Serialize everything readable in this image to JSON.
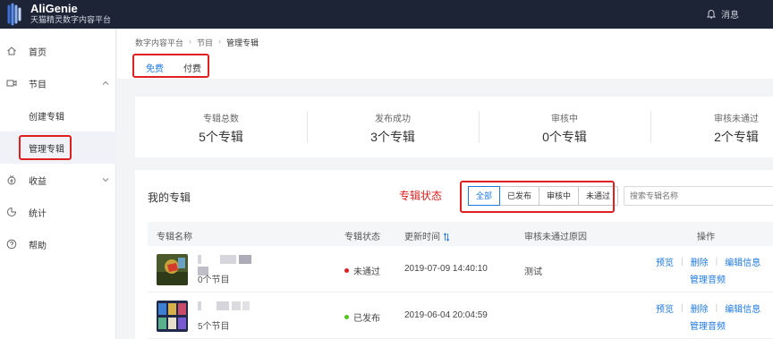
{
  "app": {
    "name": "AliGenie",
    "subtitle": "天猫精灵数字内容平台"
  },
  "topbar": {
    "notify_label": "消息"
  },
  "sidebar": {
    "items": [
      {
        "label": "首页",
        "icon": "home-icon"
      },
      {
        "label": "节目",
        "icon": "video-icon"
      },
      {
        "label": "创建专辑"
      },
      {
        "label": "管理专辑"
      },
      {
        "label": "收益",
        "icon": "money-icon"
      },
      {
        "label": "统计",
        "icon": "chart-icon"
      },
      {
        "label": "帮助",
        "icon": "help-icon"
      }
    ]
  },
  "breadcrumb": [
    "数字内容平台",
    "节目",
    "管理专辑"
  ],
  "tabs": [
    {
      "label": "免费",
      "active": true
    },
    {
      "label": "付费",
      "active": false
    }
  ],
  "stats": [
    {
      "title": "专辑总数",
      "value": "5个专辑"
    },
    {
      "title": "发布成功",
      "value": "3个专辑"
    },
    {
      "title": "审核中",
      "value": "0个专辑"
    },
    {
      "title": "审核未通过",
      "value": "2个专辑"
    }
  ],
  "albums": {
    "title": "我的专辑",
    "status_annotation": "专辑状态",
    "filters": [
      "全部",
      "已发布",
      "审核中",
      "未通过"
    ],
    "selected_filter": "全部",
    "search_placeholder": "搜索专辑名称",
    "columns": [
      "专辑名称",
      "专辑状态",
      "更新时间",
      "审核未通过原因",
      "操作"
    ],
    "rows": [
      {
        "count": "0个节目",
        "status": "未通过",
        "status_color": "#e02020",
        "updated": "2019-07-09 14:40:10",
        "reason": "测试",
        "actions": [
          "预览",
          "删除",
          "编辑信息",
          "管理音频"
        ]
      },
      {
        "count": "5个节目",
        "status": "已发布",
        "status_color": "#52c41a",
        "updated": "2019-06-04 20:04:59",
        "reason": "",
        "actions": [
          "预览",
          "删除",
          "编辑信息",
          "管理音频"
        ]
      }
    ]
  },
  "colors": {
    "accent": "#1f7ae0",
    "topbar": "#1c2436",
    "annotation": "#e02020"
  }
}
